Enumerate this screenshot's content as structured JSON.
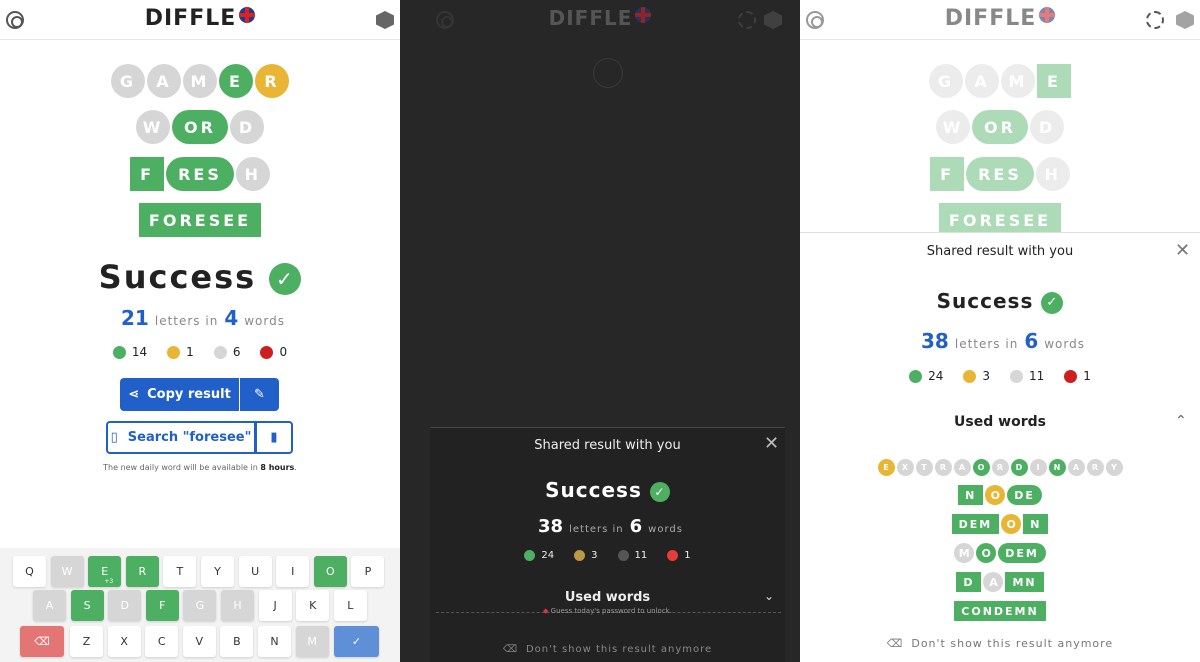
{
  "app": {
    "title": "DIFFLE"
  },
  "colors": {
    "green": "#4caf62",
    "yellow": "#e8b634",
    "gray": "#d6d6d6",
    "red": "#cc1f1f",
    "blue": "#2260c9"
  },
  "panel1": {
    "rows": [
      [
        {
          "t": "G",
          "c": "gr",
          "s": "c"
        },
        {
          "t": "A",
          "c": "gr",
          "s": "c"
        },
        {
          "t": "M",
          "c": "gr",
          "s": "c"
        },
        {
          "t": "E",
          "c": "g",
          "s": "c"
        },
        {
          "t": "R",
          "c": "y",
          "s": "c"
        }
      ],
      [
        {
          "t": "W",
          "c": "gr",
          "s": "c"
        },
        {
          "t": "OR",
          "c": "g",
          "s": "pill"
        },
        {
          "t": "D",
          "c": "gr",
          "s": "c"
        }
      ],
      [
        {
          "t": "F",
          "c": "g",
          "s": "sq"
        },
        {
          "t": "RES",
          "c": "g",
          "s": "pill"
        },
        {
          "t": "H",
          "c": "gr",
          "s": "c"
        }
      ],
      [
        {
          "t": "FORESEE",
          "c": "g",
          "s": "sq"
        }
      ]
    ],
    "success": "Success",
    "letters": "21",
    "letters_in": "letters in",
    "words": "4",
    "words_label": "words",
    "counts": {
      "green": "14",
      "yellow": "1",
      "gray": "6",
      "red": "0"
    },
    "copy_label": "Copy result",
    "search_label": "Search \"foresee\"",
    "note_prefix": "The new daily word will be available in",
    "note_bold": "8 hours",
    "note_suffix": ".",
    "keyboard": [
      [
        {
          "k": "Q"
        },
        {
          "k": "W",
          "s": "gr"
        },
        {
          "k": "E",
          "s": "g",
          "sub": "+3"
        },
        {
          "k": "R",
          "s": "g"
        },
        {
          "k": "T"
        },
        {
          "k": "Y"
        },
        {
          "k": "U"
        },
        {
          "k": "I"
        },
        {
          "k": "O",
          "s": "g"
        },
        {
          "k": "P"
        }
      ],
      [
        {
          "k": "A",
          "s": "gr"
        },
        {
          "k": "S",
          "s": "g"
        },
        {
          "k": "D",
          "s": "gr"
        },
        {
          "k": "F",
          "s": "g"
        },
        {
          "k": "G",
          "s": "gr"
        },
        {
          "k": "H",
          "s": "gr"
        },
        {
          "k": "J"
        },
        {
          "k": "K"
        },
        {
          "k": "L"
        }
      ],
      [
        {
          "k": "Z"
        },
        {
          "k": "X"
        },
        {
          "k": "C"
        },
        {
          "k": "V"
        },
        {
          "k": "B"
        },
        {
          "k": "N"
        },
        {
          "k": "M",
          "s": "gr"
        }
      ]
    ]
  },
  "panel2": {
    "shared_title": "Shared result with you",
    "success": "Success",
    "letters": "38",
    "letters_in": "letters in",
    "words": "6",
    "words_label": "words",
    "counts": {
      "green": "24",
      "yellow": "3",
      "gray": "11",
      "red": "1"
    },
    "used_words": "Used words",
    "unlock_note": "Guess today's password to unlock.",
    "dont_show": "Don't show this result anymore"
  },
  "panel3": {
    "rows": [
      [
        {
          "t": "G",
          "c": "gr",
          "s": "c"
        },
        {
          "t": "A",
          "c": "gr",
          "s": "c"
        },
        {
          "t": "M",
          "c": "gr",
          "s": "c"
        },
        {
          "t": "E",
          "c": "g",
          "s": "sq"
        }
      ],
      [
        {
          "t": "W",
          "c": "gr",
          "s": "c"
        },
        {
          "t": "OR",
          "c": "g",
          "s": "pill"
        },
        {
          "t": "D",
          "c": "gr",
          "s": "c"
        }
      ],
      [
        {
          "t": "F",
          "c": "g",
          "s": "sq"
        },
        {
          "t": "RES",
          "c": "g",
          "s": "pill"
        },
        {
          "t": "H",
          "c": "gr",
          "s": "c"
        }
      ],
      [
        {
          "t": "FORESEE",
          "c": "g",
          "s": "sq"
        }
      ]
    ],
    "shared_title": "Shared result with you",
    "success": "Success",
    "letters": "38",
    "letters_in": "letters in",
    "words": "6",
    "words_label": "words",
    "counts": {
      "green": "24",
      "yellow": "3",
      "gray": "11",
      "red": "1"
    },
    "used_words": "Used words",
    "mini_rows": [
      [
        {
          "t": "E",
          "c": "y",
          "s": "mc"
        },
        {
          "t": "X",
          "c": "gr",
          "s": "mc"
        },
        {
          "t": "T",
          "c": "gr",
          "s": "mc"
        },
        {
          "t": "R",
          "c": "gr",
          "s": "mc"
        },
        {
          "t": "A",
          "c": "gr",
          "s": "mc"
        },
        {
          "t": "O",
          "c": "g",
          "s": "mc"
        },
        {
          "t": "R",
          "c": "gr",
          "s": "mc"
        },
        {
          "t": "D",
          "c": "g",
          "s": "mc"
        },
        {
          "t": "I",
          "c": "gr",
          "s": "mc"
        },
        {
          "t": "N",
          "c": "g",
          "s": "mc"
        },
        {
          "t": "A",
          "c": "gr",
          "s": "mc"
        },
        {
          "t": "R",
          "c": "gr",
          "s": "mc"
        },
        {
          "t": "Y",
          "c": "gr",
          "s": "mc"
        }
      ],
      [
        {
          "t": "N",
          "c": "g",
          "s": "mp"
        },
        {
          "t": "O",
          "c": "y",
          "s": "mcb"
        },
        {
          "t": "DE",
          "c": "g",
          "s": "mpr"
        }
      ],
      [
        {
          "t": "DEM",
          "c": "g",
          "s": "mp"
        },
        {
          "t": "O",
          "c": "y",
          "s": "mcb"
        },
        {
          "t": "N",
          "c": "g",
          "s": "mp"
        }
      ],
      [
        {
          "t": "M",
          "c": "gr",
          "s": "mcb"
        },
        {
          "t": "O",
          "c": "g",
          "s": "mcb"
        },
        {
          "t": "DEM",
          "c": "g",
          "s": "mpr"
        }
      ],
      [
        {
          "t": "D",
          "c": "g",
          "s": "mp"
        },
        {
          "t": "A",
          "c": "gr",
          "s": "mcb"
        },
        {
          "t": "MN",
          "c": "g",
          "s": "mp"
        }
      ],
      [
        {
          "t": "CONDEMN",
          "c": "g",
          "s": "mp"
        }
      ]
    ],
    "dont_show": "Don't show this result anymore"
  }
}
